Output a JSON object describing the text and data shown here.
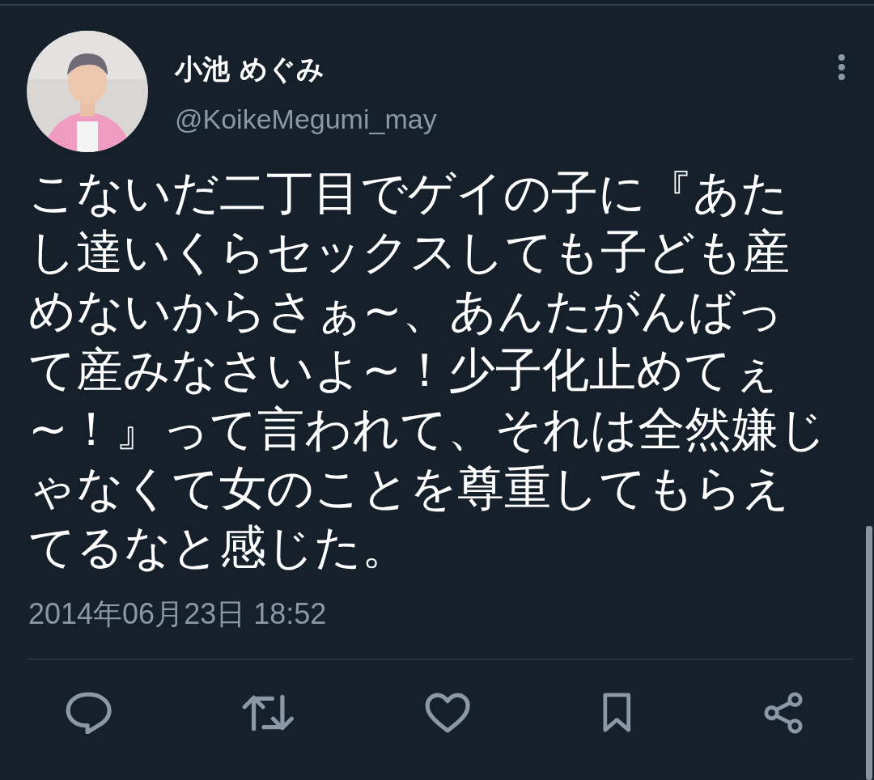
{
  "author": {
    "name": "小池 めぐみ",
    "handle": "@KoikeMegumi_may"
  },
  "tweet": {
    "text": "こないだ二丁目でゲイの子に『あたし達いくらセックスしても子ども産めないからさぁ~、あんたがんばって産みなさいよ~！少子化止めてぇ~！』って言われて、それは全然嫌じゃなくて女のことを尊重してもらえてるなと感じた。",
    "timestamp": "2014年06月23日 18:52"
  },
  "actions": [
    {
      "kind": "reply"
    },
    {
      "kind": "retweet"
    },
    {
      "kind": "like"
    },
    {
      "kind": "bookmark"
    },
    {
      "kind": "share"
    }
  ]
}
